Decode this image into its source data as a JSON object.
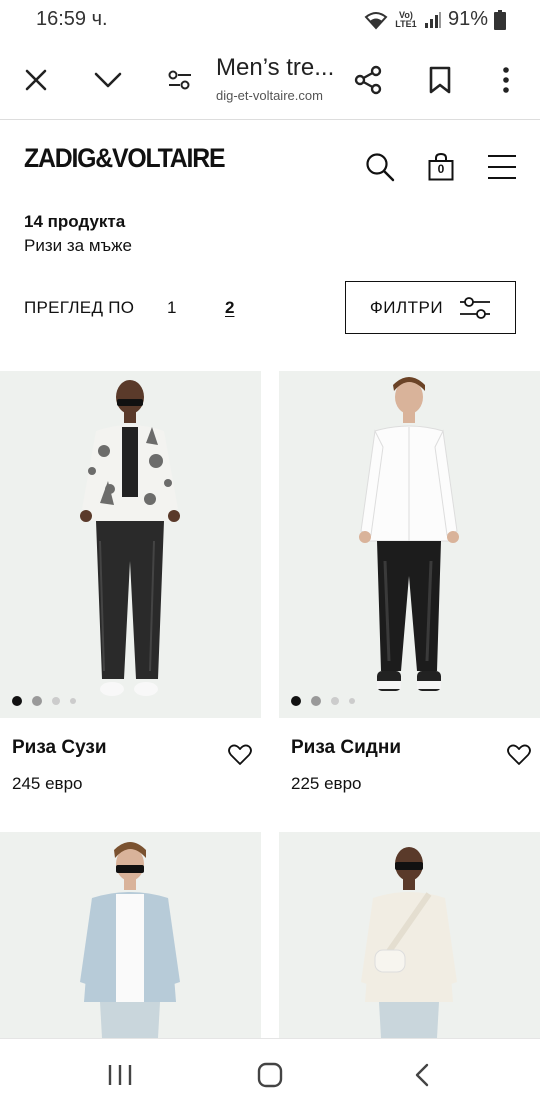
{
  "status": {
    "time": "16:59 ч.",
    "battery": "91%",
    "network": "Vo) LTE1"
  },
  "browser": {
    "title": "Men’s tre...",
    "url": "dig-et-voltaire.com"
  },
  "site": {
    "logo": "ZADIG&VOLTAIRE",
    "bag_count": "0"
  },
  "listing": {
    "count": "14 продукта",
    "category": "Ризи за мъже",
    "view_label": "ПРЕГЛЕД ПО",
    "pages": [
      "1",
      "2"
    ],
    "current_page": "2",
    "filter_label": "ФИЛТРИ"
  },
  "products": [
    {
      "name": "Риза Сузи",
      "price": "245 евро"
    },
    {
      "name": "Риза Сидни",
      "price": "225 евро"
    },
    {
      "name": "",
      "price": ""
    },
    {
      "name": "",
      "price": ""
    }
  ],
  "colors": {
    "card_bg": "#eef1ee",
    "text": "#111111",
    "accent": "#111111"
  }
}
